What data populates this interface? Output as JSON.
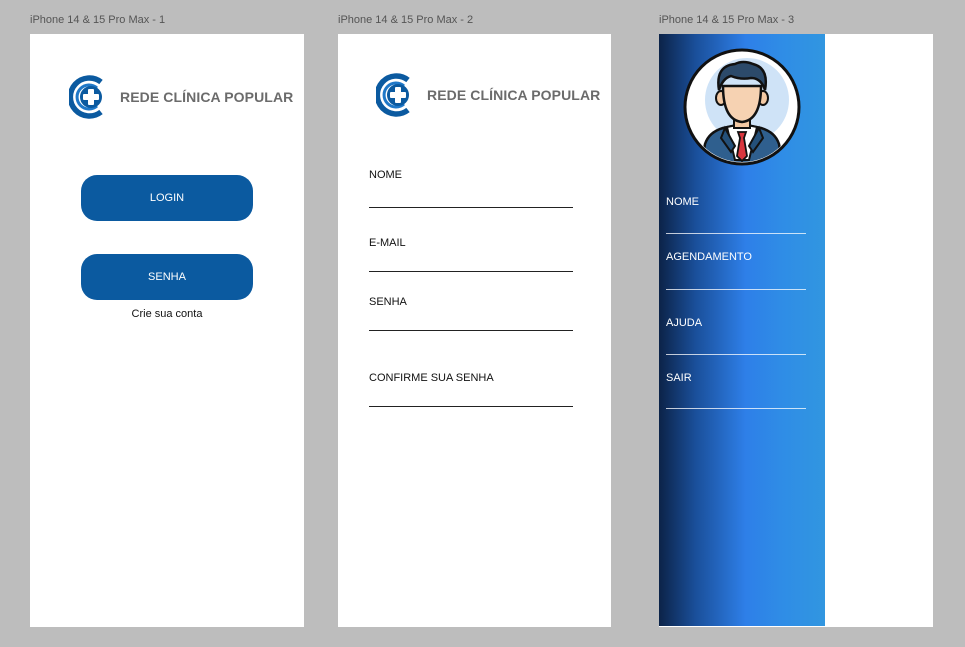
{
  "frames": [
    {
      "label": "iPhone 14 & 15 Pro Max - 1"
    },
    {
      "label": "iPhone 14 & 15 Pro Max - 2"
    },
    {
      "label": "iPhone 14 & 15 Pro Max - 3"
    }
  ],
  "brand": {
    "name": "REDE CLÍNICA POPULAR",
    "logo_icon": "medical-cross-logo-icon",
    "primary_color": "#0b5aa0",
    "text_color": "#6b6b6b"
  },
  "login_screen": {
    "login_button": "LOGIN",
    "password_button": "SENHA",
    "create_account_link": "Crie sua conta"
  },
  "signup_screen": {
    "fields": [
      {
        "label": "NOME"
      },
      {
        "label": "E-MAIL"
      },
      {
        "label": "SENHA"
      },
      {
        "label": "CONFIRME SUA SENHA"
      }
    ]
  },
  "menu_screen": {
    "avatar_icon": "businessman-avatar-icon",
    "items": [
      {
        "label": "NOME"
      },
      {
        "label": "AGENDAMENTO"
      },
      {
        "label": "AJUDA"
      },
      {
        "label": "SAIR"
      }
    ],
    "gradient_colors": [
      "#0c2348",
      "#2e7fe8",
      "#3196e0"
    ]
  }
}
